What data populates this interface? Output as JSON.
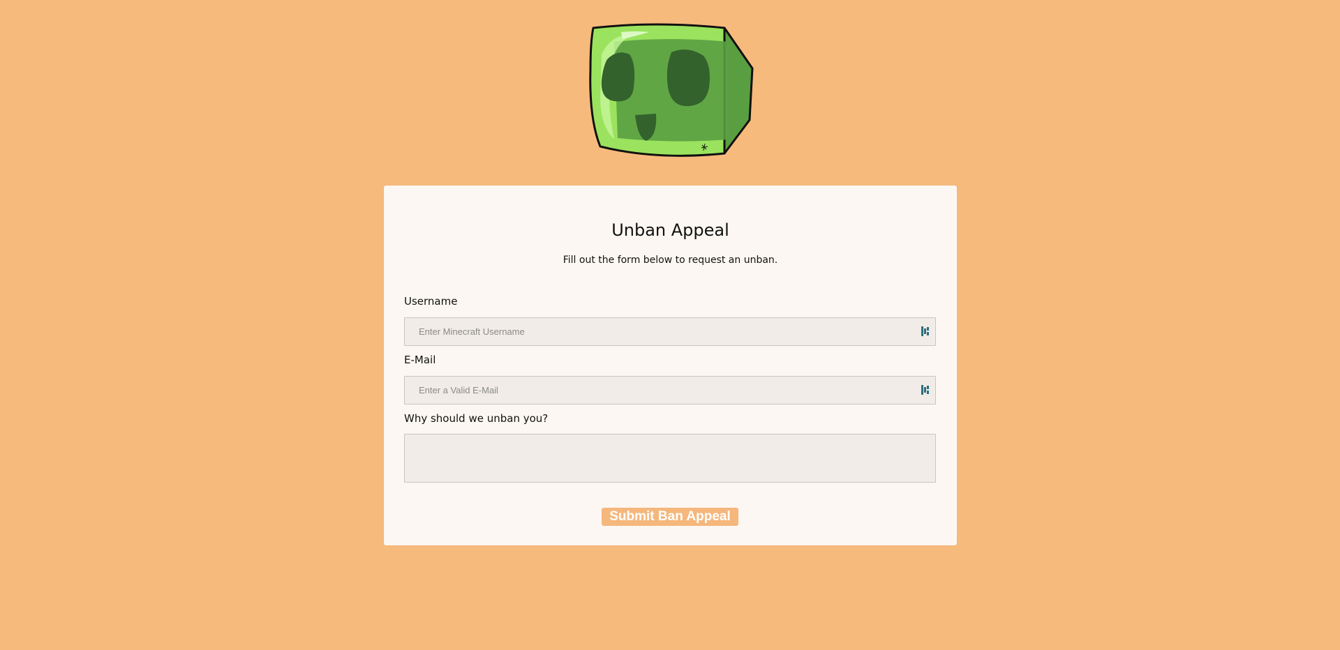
{
  "form": {
    "title": "Unban Appeal",
    "subtitle": "Fill out the form below to request an unban.",
    "username": {
      "label": "Username",
      "placeholder": "Enter Minecraft Username",
      "value": ""
    },
    "email": {
      "label": "E-Mail",
      "placeholder": "Enter a Valid E-Mail",
      "value": ""
    },
    "reason": {
      "label": "Why should we unban you?",
      "value": ""
    },
    "submit_label": "Submit Ban Appeal"
  },
  "logo": {
    "icon": "slime-cube-icon",
    "colors": {
      "light": "#9BE35E",
      "mid": "#5A9E42",
      "dark": "#33622C",
      "outline": "#111111"
    }
  },
  "colors": {
    "background": "#F7BA7D",
    "card": "#FCF7F2",
    "input_bg": "#F1ECE7",
    "button": "#F5B77C",
    "password_manager_icon": "#2D6F7E"
  }
}
